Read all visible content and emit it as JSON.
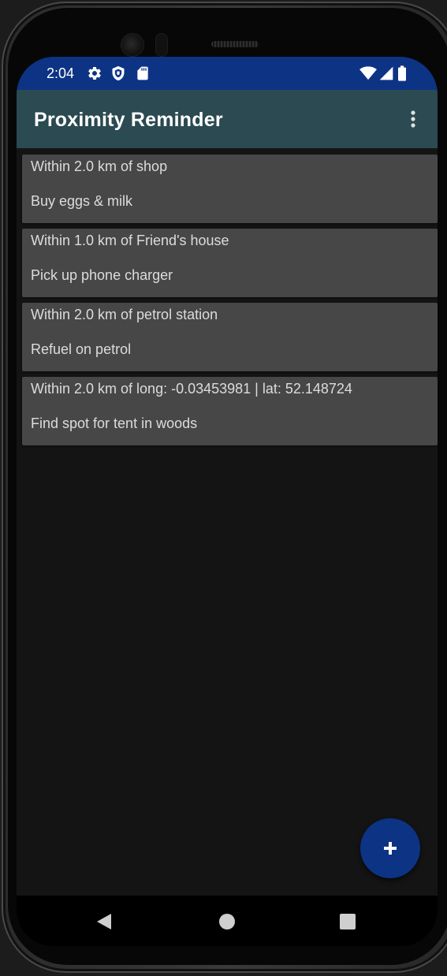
{
  "status_bar": {
    "time": "2:04",
    "left_icons": [
      "gear-icon",
      "shield-icon",
      "sd-card-icon"
    ],
    "right_icons": [
      "wifi-icon",
      "signal-icon",
      "battery-icon"
    ],
    "background_color": "#0d3384"
  },
  "app_bar": {
    "title": "Proximity Reminder",
    "menu_icon": "more-vert-icon",
    "background_color": "#2b4a52"
  },
  "reminders": [
    {
      "title": "Within 2.0 km of shop",
      "note": "Buy eggs & milk"
    },
    {
      "title": "Within 1.0 km of Friend's house",
      "note": "Pick up phone charger"
    },
    {
      "title": "Within 2.0 km of petrol station",
      "note": "Refuel on petrol"
    },
    {
      "title": "Within 2.0 km of long: -0.03453981 | lat: 52.148724",
      "note": "Find spot for tent in woods"
    }
  ],
  "fab": {
    "icon": "plus-icon",
    "color": "#0d3384"
  },
  "nav_bar": {
    "back_icon": "back-triangle-icon",
    "home_icon": "home-circle-icon",
    "recents_icon": "recents-square-icon"
  },
  "colors": {
    "background": "#141414",
    "card": "#474747",
    "card_text": "#dcdcdc"
  }
}
